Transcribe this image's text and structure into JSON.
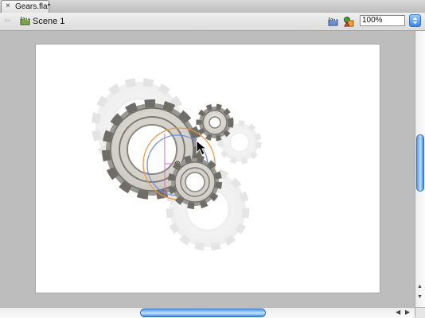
{
  "document_tab": {
    "close_glyph": "×",
    "title": "Gears.fla*"
  },
  "edit_bar": {
    "back_glyph": "⇦",
    "scene_label": "Scene 1",
    "zoom_value": "100%",
    "icons": [
      "scene-clapper-icon",
      "edit-scene-icon",
      "edit-symbol-icon",
      "zoom-dropdown-icon"
    ]
  },
  "scrollbars": {
    "up_glyph": "▲",
    "down_glyph": "▼",
    "left_glyph": "◀",
    "right_glyph": "▶"
  },
  "colors": {
    "stage": "#ffffff",
    "workarea": "#bdbdbd",
    "accent": "#3f86e4"
  }
}
